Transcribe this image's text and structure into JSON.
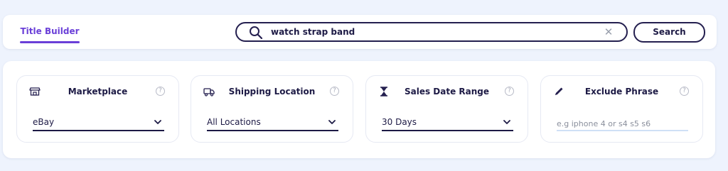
{
  "tabs": [
    {
      "label": "Title Builder",
      "active": true
    }
  ],
  "search": {
    "value": "watch strap band",
    "clear_label": "✕",
    "button_label": "Search"
  },
  "filters": [
    {
      "title": "Marketplace",
      "icon": "store-icon",
      "value": "eBay",
      "type": "select"
    },
    {
      "title": "Shipping Location",
      "icon": "truck-icon",
      "value": "All Locations",
      "type": "select"
    },
    {
      "title": "Sales Date Range",
      "icon": "hourglass-icon",
      "value": "30 Days",
      "type": "select"
    },
    {
      "title": "Exclude Phrase",
      "icon": "pencil-icon",
      "placeholder": "e.g iphone 4 or s4 s5 s6",
      "type": "text"
    }
  ],
  "help_label": "?",
  "colors": {
    "accent": "#6a3fd8",
    "dark": "#241f4f",
    "background": "#eef3fd",
    "panel": "#ffffff"
  }
}
